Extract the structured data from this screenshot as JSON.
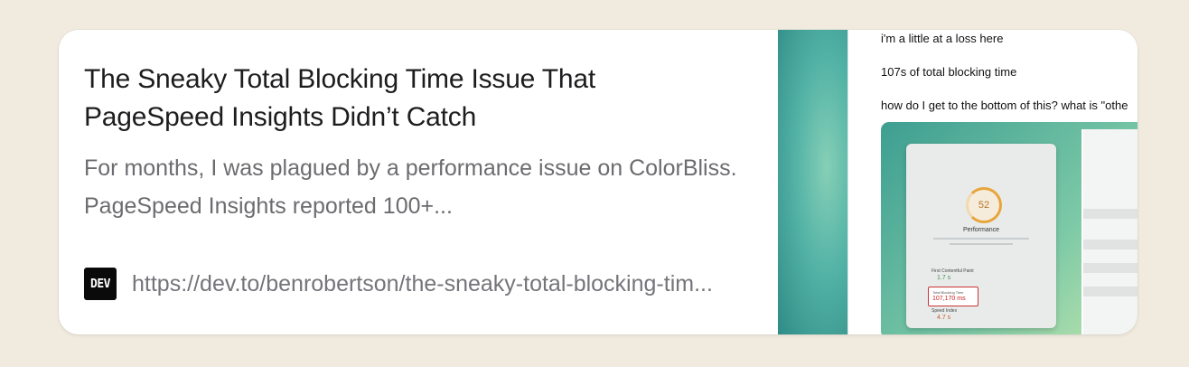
{
  "card": {
    "title": "The Sneaky Total Blocking Time Issue That PageSpeed Insights Didn’t Catch",
    "description": "For months, I was plagued by a performance issue on ColorBliss. PageSpeed Insights reported 100+...",
    "source_logo_text": "DEV",
    "url": "https://dev.to/benrobertson/the-sneaky-total-blocking-tim..."
  },
  "thumbnail": {
    "lines": [
      "i'm a little at a loss here",
      "107s of total blocking time",
      "how do I get to the bottom of this? what is \"othe"
    ],
    "embedded_screenshot": {
      "score": "52",
      "label": "Performance",
      "metrics": [
        {
          "name": "First Contentful Paint",
          "value": "1.7 s"
        },
        {
          "name": "Total Blocking Time",
          "value": "107,170 ms"
        },
        {
          "name": "Speed Index",
          "value": "4.7 s"
        }
      ]
    }
  },
  "colors": {
    "page_background": "#f1ebdf",
    "card_background": "#ffffff",
    "title": "#1d1d1f",
    "description": "#6c6c70",
    "accent_teal": "#53b3a6"
  }
}
